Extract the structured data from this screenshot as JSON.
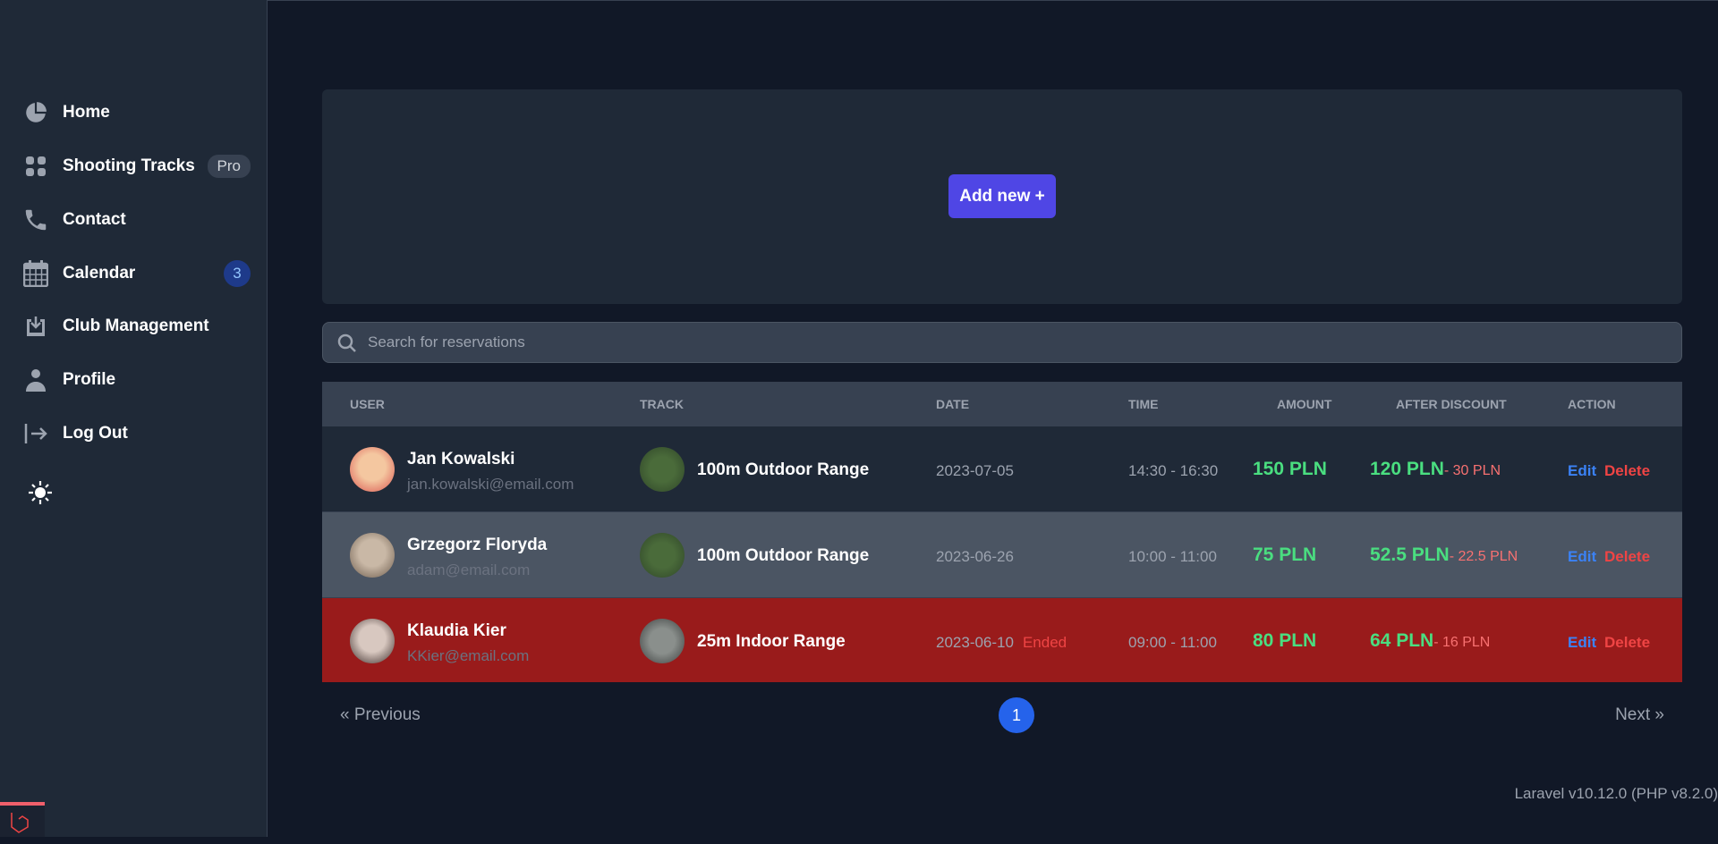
{
  "sidebar": {
    "items": [
      {
        "label": "Home",
        "icon": "pie-chart-icon"
      },
      {
        "label": "Shooting Tracks",
        "icon": "grid-icon",
        "badge": "Pro"
      },
      {
        "label": "Contact",
        "icon": "phone-icon"
      },
      {
        "label": "Calendar",
        "icon": "calendar-icon",
        "count": "3"
      },
      {
        "label": "Club Management",
        "icon": "inbox-download-icon"
      },
      {
        "label": "Profile",
        "icon": "user-icon"
      },
      {
        "label": "Log Out",
        "icon": "logout-icon"
      }
    ]
  },
  "card": {
    "add_label": "Add new +"
  },
  "search": {
    "placeholder": "Search for reservations"
  },
  "table": {
    "headers": [
      "USER",
      "TRACK",
      "DATE",
      "TIME",
      "AMOUNT",
      "AFTER DISCOUNT",
      "ACTION"
    ],
    "rows": [
      {
        "name": "Jan Kowalski",
        "email": "jan.kowalski@email.com",
        "track": "100m Outdoor Range",
        "date": "2023-07-05",
        "status": "",
        "time": "14:30 - 16:30",
        "amount": "150 PLN",
        "after": "120 PLN",
        "discount": "- 30 PLN",
        "edit": "Edit",
        "delete": "Delete",
        "bg": "#1f2937"
      },
      {
        "name": "Grzegorz Floryda",
        "email": "adam@email.com",
        "track": "100m Outdoor Range",
        "date": "2023-06-26",
        "status": "",
        "time": "10:00 - 11:00",
        "amount": "75 PLN",
        "after": "52.5 PLN",
        "discount": "- 22.5 PLN",
        "edit": "Edit",
        "delete": "Delete",
        "bg": "#4b5563"
      },
      {
        "name": "Klaudia Kier",
        "email": "KKier@email.com",
        "track": "25m Indoor Range",
        "date": "2023-06-10",
        "status": "Ended",
        "time": "09:00 - 11:00",
        "amount": "80 PLN",
        "after": "64 PLN",
        "discount": "- 16 PLN",
        "edit": "Edit",
        "delete": "Delete",
        "bg": "#991b1b"
      }
    ]
  },
  "pagination": {
    "prev": "« Previous",
    "page": "1",
    "next": "Next »"
  },
  "footer": "Laravel v10.12.0 (PHP v8.2.0)"
}
